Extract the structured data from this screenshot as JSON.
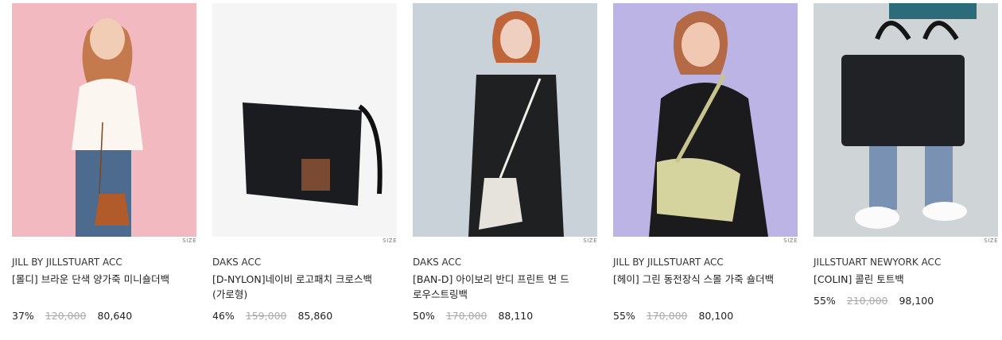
{
  "products": [
    {
      "size_label": "SIZE",
      "brand": "JILL BY JILLSTUART ACC",
      "name": "[몰디] 브라운 단색 양가죽 미니숄더백",
      "discount": "37%",
      "original_price": "120,000",
      "sale_price": "80,640",
      "image_icon": "brown-drawstring-bag-photo"
    },
    {
      "size_label": "SIZE",
      "brand": "DAKS ACC",
      "name": "[D-NYLON]네이비 로고패치 크로스백(가로형)",
      "discount": "46%",
      "original_price": "159,000",
      "sale_price": "85,860",
      "image_icon": "navy-crossbody-bag-photo"
    },
    {
      "size_label": "SIZE",
      "brand": "DAKS ACC",
      "name": "[BAN-D] 아이보리 반디 프린트 면 드로우스트링백",
      "discount": "50%",
      "original_price": "170,000",
      "sale_price": "88,110",
      "image_icon": "ivory-print-bucket-bag-photo"
    },
    {
      "size_label": "SIZE",
      "brand": "JILL BY JILLSTUART ACC",
      "name": "[헤이] 그린 동전장식 스몰 가죽 숄더백",
      "discount": "55%",
      "original_price": "170,000",
      "sale_price": "80,100",
      "image_icon": "green-shoulder-bag-photo"
    },
    {
      "size_label": "SIZE",
      "brand": "JILLSTUART NEWYORK ACC",
      "name": "[COLIN] 콜린 토트백",
      "discount": "55%",
      "original_price": "210,000",
      "sale_price": "98,100",
      "image_icon": "black-tote-bag-photo"
    }
  ],
  "colors": {
    "text": "#222222",
    "strike": "#aaaaaa",
    "bg1": "#f3b9c0",
    "bg2": "#f5f5f5",
    "bg3": "#c9d2d8",
    "bg4": "#bdb4e6",
    "bg5": "#cfd4d6"
  }
}
